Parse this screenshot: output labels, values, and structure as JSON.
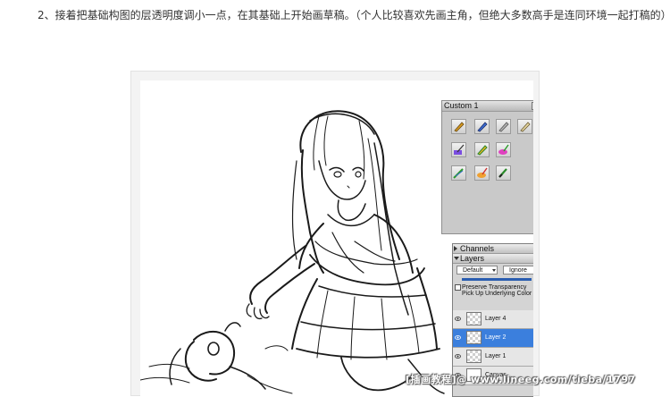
{
  "article": {
    "paragraph": "2、接着把基础构图的层透明度调小一点，在其基础上开始画草稿。（个人比较喜欢先画主角，但绝大多数高手是连同环境一起打稿的）"
  },
  "brushes_palette": {
    "title": "Custom 1",
    "brushes": [
      {
        "icon": "pen-brush-icon"
      },
      {
        "icon": "felt-pen-brush-icon"
      },
      {
        "icon": "pencil-brush-icon"
      },
      {
        "icon": "eraser-brush-icon"
      },
      {
        "icon": "palette-knife-icon"
      },
      {
        "icon": "rainbow-pen-icon"
      },
      {
        "icon": "color-blender-icon"
      },
      {
        "icon": "airbrush-icon"
      },
      {
        "icon": "marker-icon"
      },
      {
        "icon": "paint-brush-icon"
      }
    ]
  },
  "layers_palette": {
    "channels_label": "Channels",
    "layers_label": "Layers",
    "composite_method": "Default",
    "masking": "Ignore",
    "opacity": "10",
    "preserve_transparency": "Preserve Transparency",
    "pick_up_underlying": "Pick Up Underlying Color",
    "layers": [
      {
        "name": "Layer 4",
        "selected": false
      },
      {
        "name": "Layer 2",
        "selected": true
      },
      {
        "name": "Layer 1",
        "selected": false
      },
      {
        "name": "Canvas",
        "selected": false
      }
    ]
  },
  "watermark": "[插画教程]@ www.lineeg.com/tieba/1797"
}
